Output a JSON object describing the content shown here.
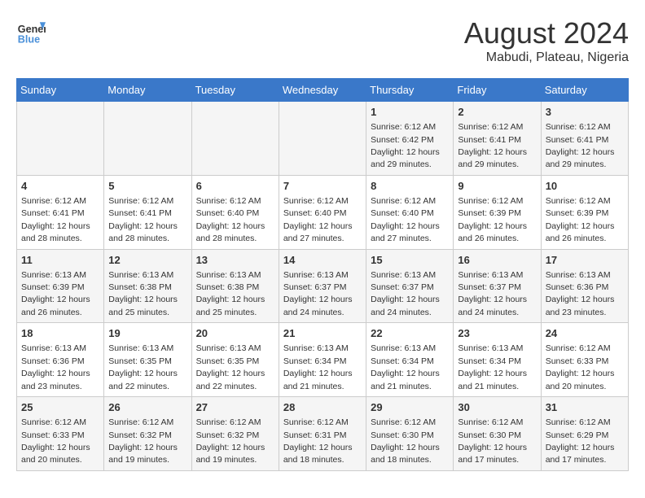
{
  "logo": {
    "text_general": "General",
    "text_blue": "Blue"
  },
  "title": "August 2024",
  "subtitle": "Mabudi, Plateau, Nigeria",
  "weekdays": [
    "Sunday",
    "Monday",
    "Tuesday",
    "Wednesday",
    "Thursday",
    "Friday",
    "Saturday"
  ],
  "weeks": [
    [
      {
        "day": "",
        "info": ""
      },
      {
        "day": "",
        "info": ""
      },
      {
        "day": "",
        "info": ""
      },
      {
        "day": "",
        "info": ""
      },
      {
        "day": "1",
        "info": "Sunrise: 6:12 AM\nSunset: 6:42 PM\nDaylight: 12 hours\nand 29 minutes."
      },
      {
        "day": "2",
        "info": "Sunrise: 6:12 AM\nSunset: 6:41 PM\nDaylight: 12 hours\nand 29 minutes."
      },
      {
        "day": "3",
        "info": "Sunrise: 6:12 AM\nSunset: 6:41 PM\nDaylight: 12 hours\nand 29 minutes."
      }
    ],
    [
      {
        "day": "4",
        "info": "Sunrise: 6:12 AM\nSunset: 6:41 PM\nDaylight: 12 hours\nand 28 minutes."
      },
      {
        "day": "5",
        "info": "Sunrise: 6:12 AM\nSunset: 6:41 PM\nDaylight: 12 hours\nand 28 minutes."
      },
      {
        "day": "6",
        "info": "Sunrise: 6:12 AM\nSunset: 6:40 PM\nDaylight: 12 hours\nand 28 minutes."
      },
      {
        "day": "7",
        "info": "Sunrise: 6:12 AM\nSunset: 6:40 PM\nDaylight: 12 hours\nand 27 minutes."
      },
      {
        "day": "8",
        "info": "Sunrise: 6:12 AM\nSunset: 6:40 PM\nDaylight: 12 hours\nand 27 minutes."
      },
      {
        "day": "9",
        "info": "Sunrise: 6:12 AM\nSunset: 6:39 PM\nDaylight: 12 hours\nand 26 minutes."
      },
      {
        "day": "10",
        "info": "Sunrise: 6:12 AM\nSunset: 6:39 PM\nDaylight: 12 hours\nand 26 minutes."
      }
    ],
    [
      {
        "day": "11",
        "info": "Sunrise: 6:13 AM\nSunset: 6:39 PM\nDaylight: 12 hours\nand 26 minutes."
      },
      {
        "day": "12",
        "info": "Sunrise: 6:13 AM\nSunset: 6:38 PM\nDaylight: 12 hours\nand 25 minutes."
      },
      {
        "day": "13",
        "info": "Sunrise: 6:13 AM\nSunset: 6:38 PM\nDaylight: 12 hours\nand 25 minutes."
      },
      {
        "day": "14",
        "info": "Sunrise: 6:13 AM\nSunset: 6:37 PM\nDaylight: 12 hours\nand 24 minutes."
      },
      {
        "day": "15",
        "info": "Sunrise: 6:13 AM\nSunset: 6:37 PM\nDaylight: 12 hours\nand 24 minutes."
      },
      {
        "day": "16",
        "info": "Sunrise: 6:13 AM\nSunset: 6:37 PM\nDaylight: 12 hours\nand 24 minutes."
      },
      {
        "day": "17",
        "info": "Sunrise: 6:13 AM\nSunset: 6:36 PM\nDaylight: 12 hours\nand 23 minutes."
      }
    ],
    [
      {
        "day": "18",
        "info": "Sunrise: 6:13 AM\nSunset: 6:36 PM\nDaylight: 12 hours\nand 23 minutes."
      },
      {
        "day": "19",
        "info": "Sunrise: 6:13 AM\nSunset: 6:35 PM\nDaylight: 12 hours\nand 22 minutes."
      },
      {
        "day": "20",
        "info": "Sunrise: 6:13 AM\nSunset: 6:35 PM\nDaylight: 12 hours\nand 22 minutes."
      },
      {
        "day": "21",
        "info": "Sunrise: 6:13 AM\nSunset: 6:34 PM\nDaylight: 12 hours\nand 21 minutes."
      },
      {
        "day": "22",
        "info": "Sunrise: 6:13 AM\nSunset: 6:34 PM\nDaylight: 12 hours\nand 21 minutes."
      },
      {
        "day": "23",
        "info": "Sunrise: 6:13 AM\nSunset: 6:34 PM\nDaylight: 12 hours\nand 21 minutes."
      },
      {
        "day": "24",
        "info": "Sunrise: 6:12 AM\nSunset: 6:33 PM\nDaylight: 12 hours\nand 20 minutes."
      }
    ],
    [
      {
        "day": "25",
        "info": "Sunrise: 6:12 AM\nSunset: 6:33 PM\nDaylight: 12 hours\nand 20 minutes."
      },
      {
        "day": "26",
        "info": "Sunrise: 6:12 AM\nSunset: 6:32 PM\nDaylight: 12 hours\nand 19 minutes."
      },
      {
        "day": "27",
        "info": "Sunrise: 6:12 AM\nSunset: 6:32 PM\nDaylight: 12 hours\nand 19 minutes."
      },
      {
        "day": "28",
        "info": "Sunrise: 6:12 AM\nSunset: 6:31 PM\nDaylight: 12 hours\nand 18 minutes."
      },
      {
        "day": "29",
        "info": "Sunrise: 6:12 AM\nSunset: 6:30 PM\nDaylight: 12 hours\nand 18 minutes."
      },
      {
        "day": "30",
        "info": "Sunrise: 6:12 AM\nSunset: 6:30 PM\nDaylight: 12 hours\nand 17 minutes."
      },
      {
        "day": "31",
        "info": "Sunrise: 6:12 AM\nSunset: 6:29 PM\nDaylight: 12 hours\nand 17 minutes."
      }
    ]
  ]
}
